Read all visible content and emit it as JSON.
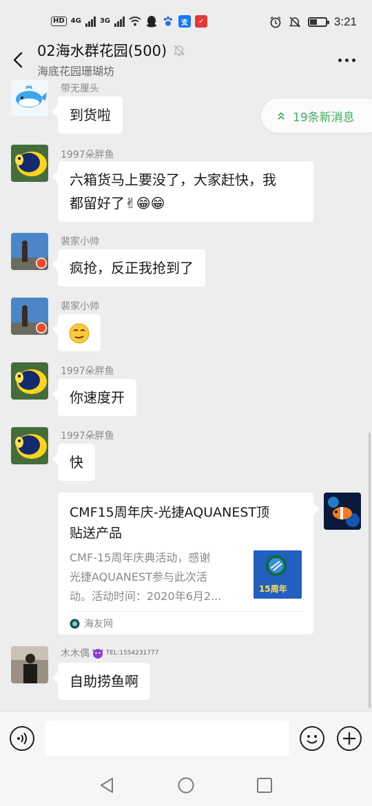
{
  "status": {
    "left_chips": [
      "HD",
      "4G",
      "3G"
    ],
    "time": "3:21",
    "battery_level": 0.45
  },
  "header": {
    "title": "02海水群花园(500)",
    "subtitle": "海底花园珊瑚坊"
  },
  "new_messages": {
    "label": "19条新消息"
  },
  "messages": [
    {
      "sender": "带无厘头",
      "text": "到货啦"
    },
    {
      "sender": "1997朵胖鱼",
      "line1": "六箱货马上要没了，大家赶快，我",
      "line2": "都留好了✌😁😁"
    },
    {
      "sender": "裴家小帅",
      "text": "疯抢，反正我抢到了"
    },
    {
      "sender": "裴家小帅",
      "text": "😏"
    },
    {
      "sender": "1997朵胖鱼",
      "text": "你速度开"
    },
    {
      "sender": "1997朵胖鱼",
      "text": "快"
    },
    {
      "sender": "木木偶",
      "badge": "TEL:1554231777",
      "text": "自助捞鱼啊"
    }
  ],
  "link_card": {
    "title_line1": "CMF15周年庆-光捷AQUANEST顶",
    "title_line2": "贴送产品",
    "desc_line1": "CMF-15周年庆典活动，感谢",
    "desc_line2": "光捷AQUANEST参与此次活",
    "desc_line3": "动。活动时间：2020年6月2...",
    "source": "海友网",
    "thumb_text": "15周年"
  },
  "colors": {
    "background": "#ededed",
    "bubble": "#ffffff",
    "accent_green": "#3fae5f",
    "sender_gray": "#888888"
  }
}
